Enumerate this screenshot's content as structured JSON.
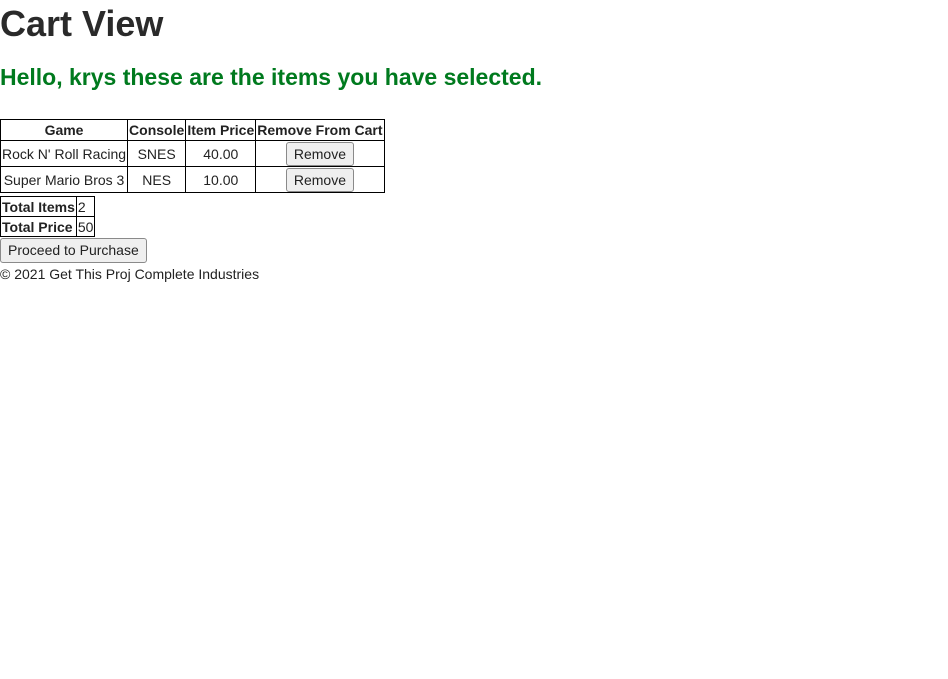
{
  "page": {
    "title": "Cart View",
    "greeting": "Hello, krys these are the items you have selected.",
    "greeting_color": "#007a1e"
  },
  "cart": {
    "headers": [
      "Game",
      "Console",
      "Item Price",
      "Remove From Cart"
    ],
    "rows": [
      {
        "game": "Rock N' Roll Racing",
        "console": "SNES",
        "price": "40.00",
        "remove_label": "Remove"
      },
      {
        "game": "Super Mario Bros 3",
        "console": "NES",
        "price": "10.00",
        "remove_label": "Remove"
      }
    ]
  },
  "totals": {
    "items_label": "Total Items",
    "items_value": "2",
    "price_label": "Total Price",
    "price_value": "50"
  },
  "actions": {
    "purchase_label": "Proceed to Purchase"
  },
  "footer": {
    "text": "© 2021 Get This Proj Complete Industries"
  }
}
